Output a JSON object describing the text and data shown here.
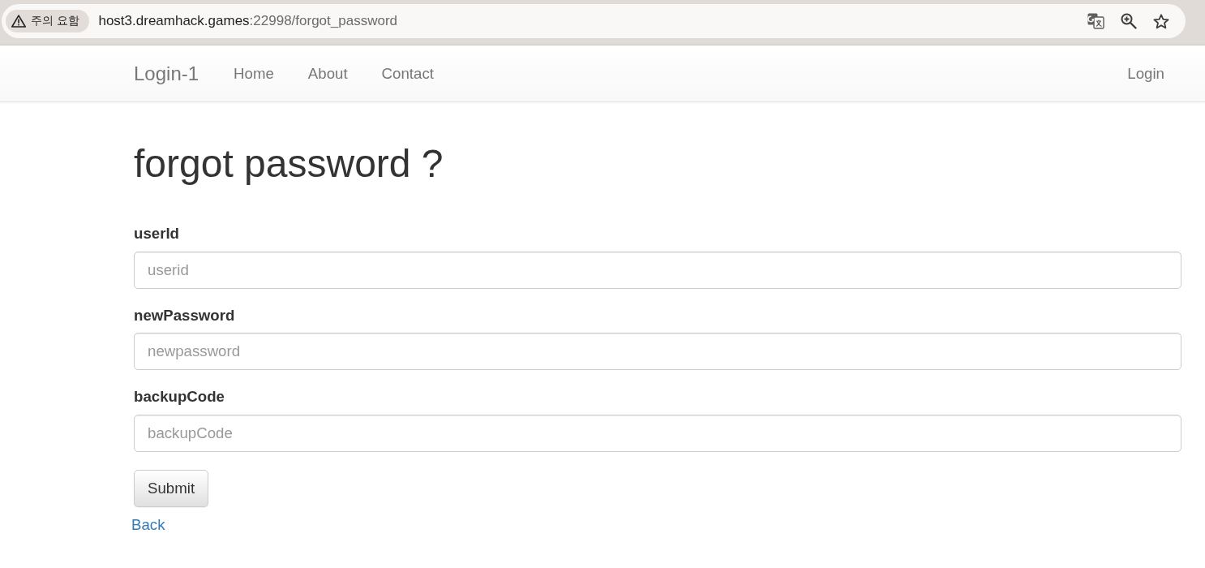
{
  "browser": {
    "security_chip": {
      "label": "주의 요함"
    },
    "url": {
      "host": "host3.dreamhack.games",
      "path": ":22998/forgot_password"
    }
  },
  "navbar": {
    "brand": "Login-1",
    "links": [
      {
        "label": "Home"
      },
      {
        "label": "About"
      },
      {
        "label": "Contact"
      }
    ],
    "right_links": [
      {
        "label": "Login"
      }
    ]
  },
  "page": {
    "title": "forgot password ?",
    "fields": [
      {
        "label": "userId",
        "placeholder": "userid"
      },
      {
        "label": "newPassword",
        "placeholder": "newpassword"
      },
      {
        "label": "backupCode",
        "placeholder": "backupCode"
      }
    ],
    "submit": "Submit",
    "back_link": "Back"
  }
}
